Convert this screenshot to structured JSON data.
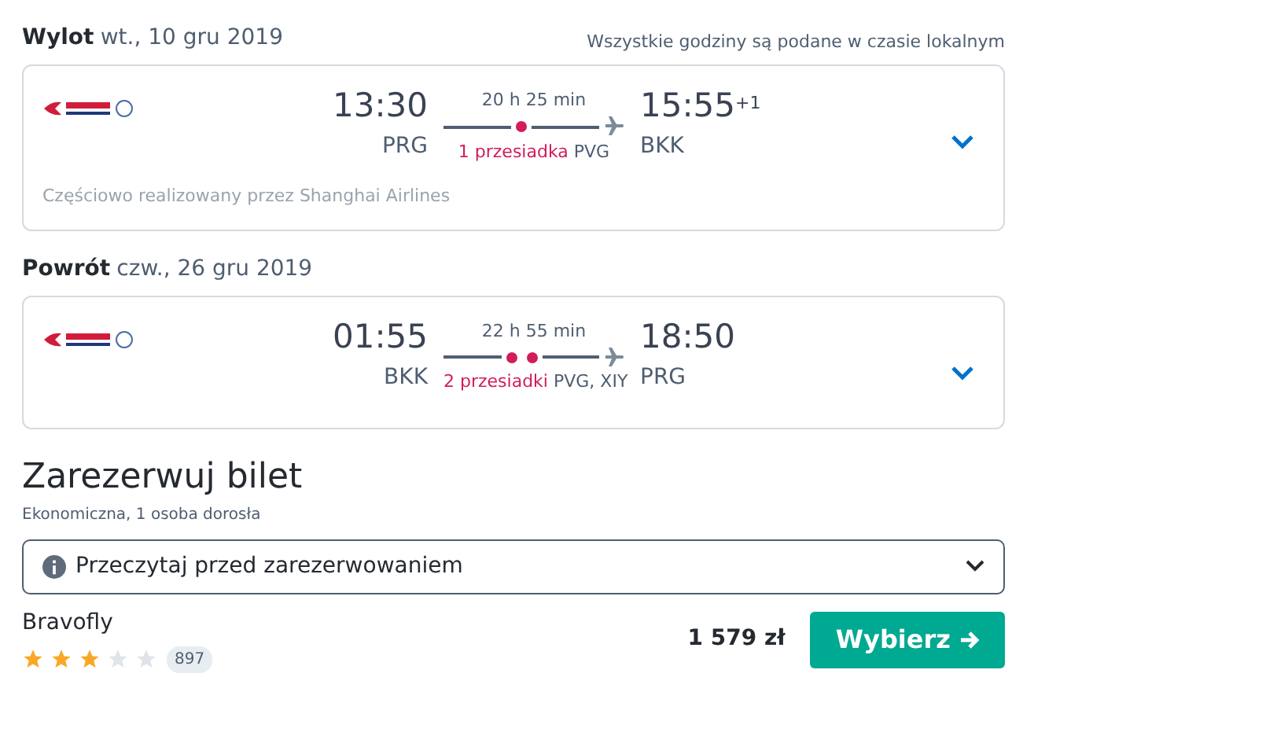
{
  "legs": [
    {
      "label": "Wylot",
      "date": "wt., 10 gru 2019",
      "note": "Wszystkie godziny są podane w czasie lokalnym",
      "depart_time": "13:30",
      "depart_airport": "PRG",
      "duration": "20 h 25 min",
      "stops_label": "1 przesiadka",
      "stops": [
        {
          "code": "PVG"
        }
      ],
      "arrive_time": "15:55",
      "day_offset": "+1",
      "arrive_airport": "BKK",
      "operated_by": "Częściowo realizowany przez Shanghai Airlines"
    },
    {
      "label": "Powrót",
      "date": "czw., 26 gru 2019",
      "depart_time": "01:55",
      "depart_airport": "BKK",
      "duration": "22 h 55 min",
      "stops_label": "2 przesiadki",
      "stops": [
        {
          "code": "PVG,"
        },
        {
          "code": "XIY"
        }
      ],
      "arrive_time": "18:50",
      "arrive_airport": "PRG"
    }
  ],
  "booking": {
    "title": "Zarezerwuj bilet",
    "subtitle": "Ekonomiczna, 1 osoba dorosła",
    "info_dropdown": "Przeczytaj przed zarezerwowaniem",
    "provider": "Bravofly",
    "stars": 3,
    "reviews": "897",
    "price": "1 579 zł",
    "button": "Wybierz"
  }
}
